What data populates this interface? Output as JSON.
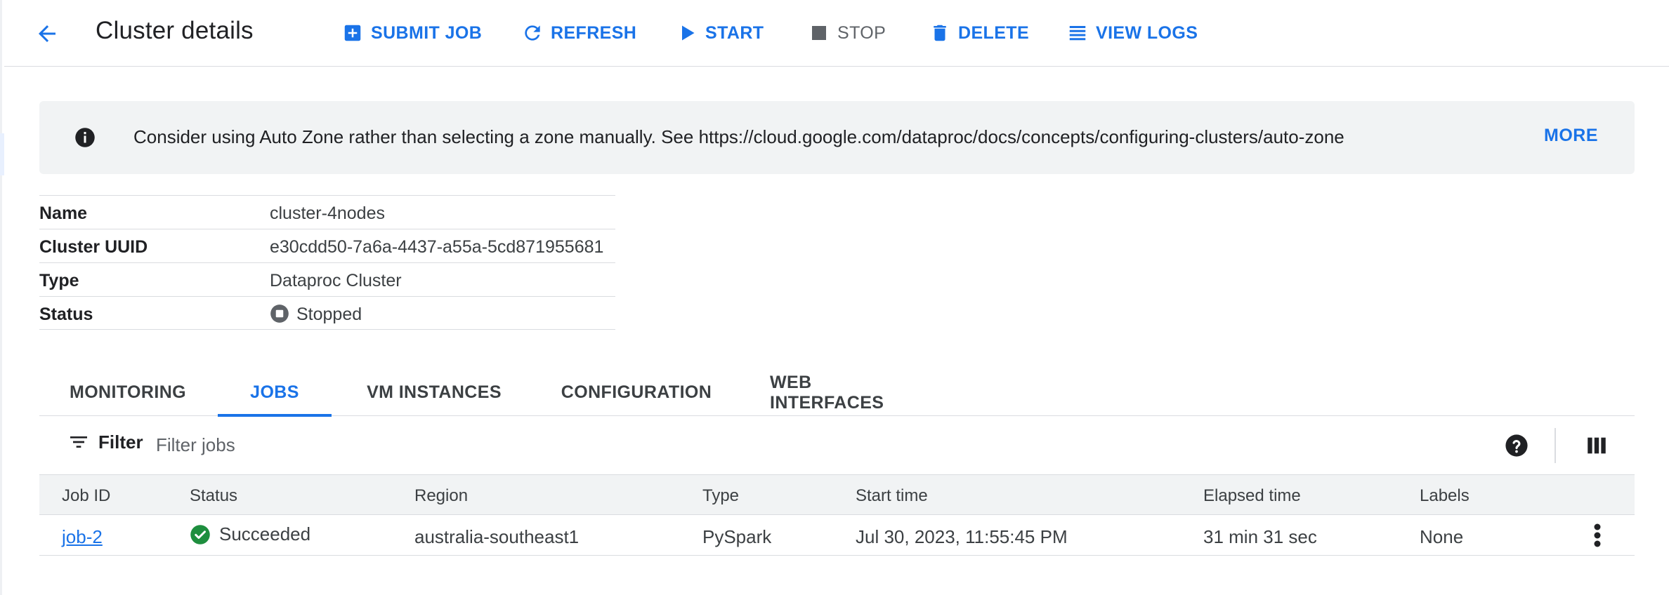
{
  "header": {
    "title": "Cluster details",
    "actions": [
      {
        "label": "SUBMIT JOB",
        "icon": "add-box-icon"
      },
      {
        "label": "REFRESH",
        "icon": "refresh-icon"
      },
      {
        "label": "START",
        "icon": "play-icon"
      },
      {
        "label": "STOP",
        "icon": "stop-icon"
      },
      {
        "label": "DELETE",
        "icon": "trash-icon"
      },
      {
        "label": "VIEW LOGS",
        "icon": "list-icon"
      }
    ]
  },
  "banner": {
    "icon": "info-icon",
    "text": "Consider using Auto Zone rather than selecting a zone manually. See https://cloud.google.com/dataproc/docs/concepts/configuring-clusters/auto-zone",
    "more_label": "MORE"
  },
  "details": [
    {
      "key": "Name",
      "value": "cluster-4nodes"
    },
    {
      "key": "Cluster UUID",
      "value": "e30cdd50-7a6a-4437-a55a-5cd871955681"
    },
    {
      "key": "Type",
      "value": "Dataproc Cluster"
    },
    {
      "key": "Status",
      "value": "Stopped"
    }
  ],
  "tabs": [
    {
      "label": "MONITORING",
      "active": false
    },
    {
      "label": "JOBS",
      "active": true
    },
    {
      "label": "VM INSTANCES",
      "active": false
    },
    {
      "label": "CONFIGURATION",
      "active": false
    },
    {
      "label": "WEB INTERFACES",
      "active": false
    }
  ],
  "filter": {
    "label": "Filter",
    "placeholder": "Filter jobs"
  },
  "jobs": {
    "columns": [
      "Job ID",
      "Status",
      "Region",
      "Type",
      "Start time",
      "Elapsed time",
      "Labels"
    ],
    "rows": [
      {
        "job_id": "job-2",
        "status": "Succeeded",
        "region": "australia-southeast1",
        "type": "PySpark",
        "start_time": "Jul 30, 2023, 11:55:45 PM",
        "elapsed_time": "31 min 31 sec",
        "labels": "None"
      }
    ]
  },
  "colors": {
    "accent": "#1a73e8",
    "success": "#1e8e3e",
    "text": "#202124",
    "muted": "#5f6368",
    "banner_bg": "#f1f3f4",
    "divider": "#dadce0"
  }
}
